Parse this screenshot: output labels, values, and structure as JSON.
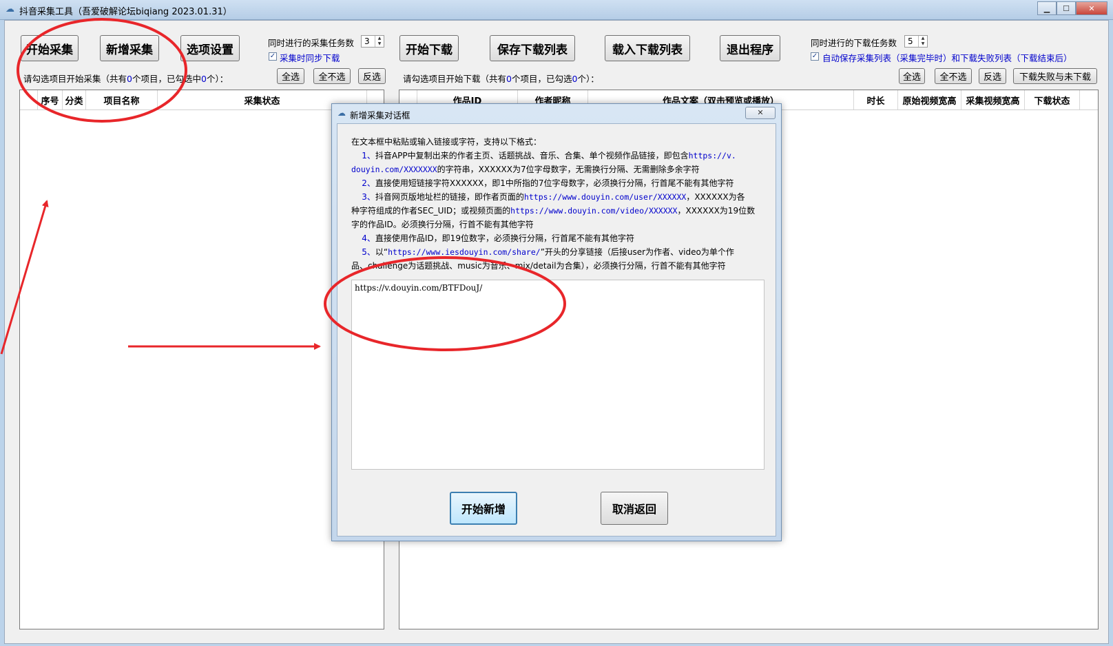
{
  "window": {
    "title": "抖音采集工具（吾爱破解论坛biqiang 2023.01.31）",
    "min": "▁",
    "max": "☐",
    "close": "✕"
  },
  "toolbar_left": {
    "start_collect": "开始采集",
    "add_collect": "新增采集",
    "options": "选项设置",
    "concurrent_label": "同时进行的采集任务数",
    "concurrent_value": "3",
    "sync_download_label": "采集时同步下载",
    "sync_download_checked": true
  },
  "toolbar_right": {
    "start_download": "开始下载",
    "save_list": "保存下载列表",
    "load_list": "载入下载列表",
    "exit": "退出程序",
    "concurrent_label": "同时进行的下载任务数",
    "concurrent_value": "5",
    "autosave_label": "自动保存采集列表（采集完毕时）和下载失败列表（下载结束后）",
    "autosave_checked": true
  },
  "left_panel": {
    "status_prefix": "请勾选项目开始采集（共有",
    "count_total": "0",
    "status_mid": "个项目，已勾选中",
    "count_checked": "0",
    "status_suffix": "个）：",
    "select_all": "全选",
    "select_none": "全不选",
    "invert": "反选",
    "columns": [
      "序号",
      "分类",
      "项目名称",
      "采集状态"
    ]
  },
  "right_panel": {
    "status_prefix": "请勾选项目开始下载（共有",
    "count_total": "0",
    "status_mid": "个项目，已勾选",
    "count_checked": "0",
    "status_suffix": "个）：",
    "select_all": "全选",
    "select_none": "全不选",
    "invert": "反选",
    "failed_undownloaded": "下载失败与未下载",
    "columns": [
      "作品ID",
      "作者昵称",
      "作品文案（双击预览或播放）",
      "时长",
      "原始视频宽高",
      "采集视频宽高",
      "下载状态"
    ]
  },
  "dialog": {
    "title": "新增采集对话框",
    "close": "✕",
    "intro": "在文本框中粘贴或输入链接或字符，支持以下格式：",
    "l1a": "1、",
    "l1b": "抖音APP中复制出来的作者主页、话题挑战、音乐、合集、单个视频作品链接，即包含",
    "l1c": "https://v.",
    "l2a": "douyin.com/XXXXXXX",
    "l2b": "的字符串，XXXXXX为7位字母数字，无需换行分隔、无需删除多余字符",
    "l3a": "2、",
    "l3b": "直接使用短链接字符XXXXXX，即1中所指的7位字母数字，必须换行分隔，行首尾不能有其他字符",
    "l4a": "3、",
    "l4b": "抖音网页版地址栏的链接，即作者页面的",
    "l4c": "https://www.douyin.com/user/XXXXXX",
    "l4d": "，XXXXXX为各",
    "l5a": "种字符组成的作者SEC_UID；或视频页面的",
    "l5b": "https://www.douyin.com/video/XXXXXX",
    "l5c": "，XXXXXX为19位数",
    "l6": "字的作品ID。必须换行分隔，行首不能有其他字符",
    "l7a": "4、",
    "l7b": "直接使用作品ID，即19位数字，必须换行分隔，行首尾不能有其他字符",
    "l8a": "5、",
    "l8b": "以“",
    "l8c": "https://www.iesdouyin.com/share/",
    "l8d": "”开头的分享链接（后接user为作者、video为单个作",
    "l9": "品、challenge为话题挑战、music为音乐、mix/detail为合集），必须换行分隔，行首不能有其他字符",
    "input_value": "https://v.douyin.com/BTFDouJ/",
    "confirm": "开始新增",
    "cancel": "取消返回"
  },
  "colors": {
    "annotation_red": "#e8262a",
    "link_blue": "#0000cc"
  }
}
